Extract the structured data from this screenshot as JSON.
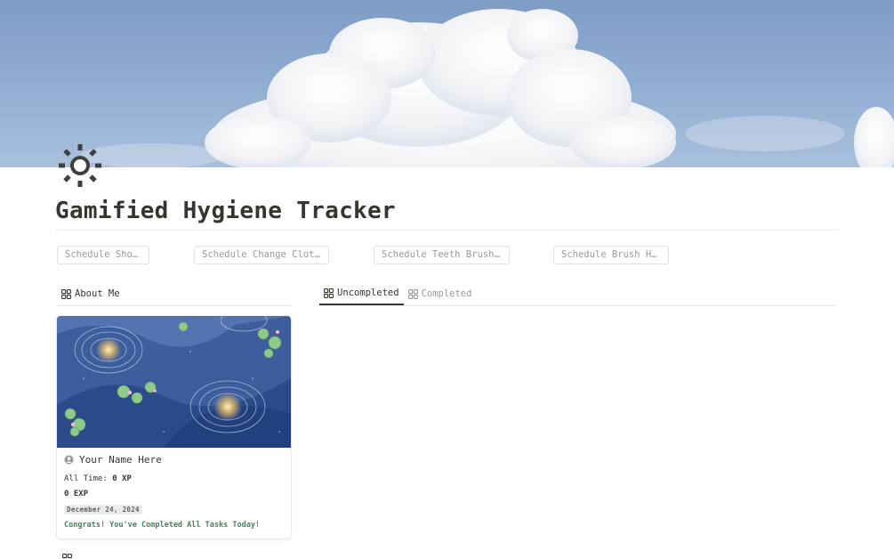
{
  "page": {
    "title": "Gamified Hygiene Tracker",
    "icon": "sun-icon"
  },
  "schedule_buttons": [
    {
      "label": "Schedule Show…"
    },
    {
      "label": "Schedule Change Cloth…"
    },
    {
      "label": "Schedule Teeth Brushi…"
    },
    {
      "label": "Schedule Brush Hair"
    }
  ],
  "about": {
    "tab_label": "About Me",
    "card": {
      "name": "Your Name Here",
      "all_time_label": "All Time:",
      "all_time_value": "0 XP",
      "exp": "0 EXP",
      "date": "December 24, 2024",
      "message": "Congrats! You've Completed All Tasks Today!"
    }
  },
  "tasks": {
    "tabs": [
      {
        "label": "Uncompleted",
        "active": true
      },
      {
        "label": "Completed",
        "active": false
      }
    ]
  },
  "colors": {
    "text": "#37352f",
    "muted": "#9b9a97",
    "congrats": "#448361",
    "sky": "#8aa7cd"
  }
}
